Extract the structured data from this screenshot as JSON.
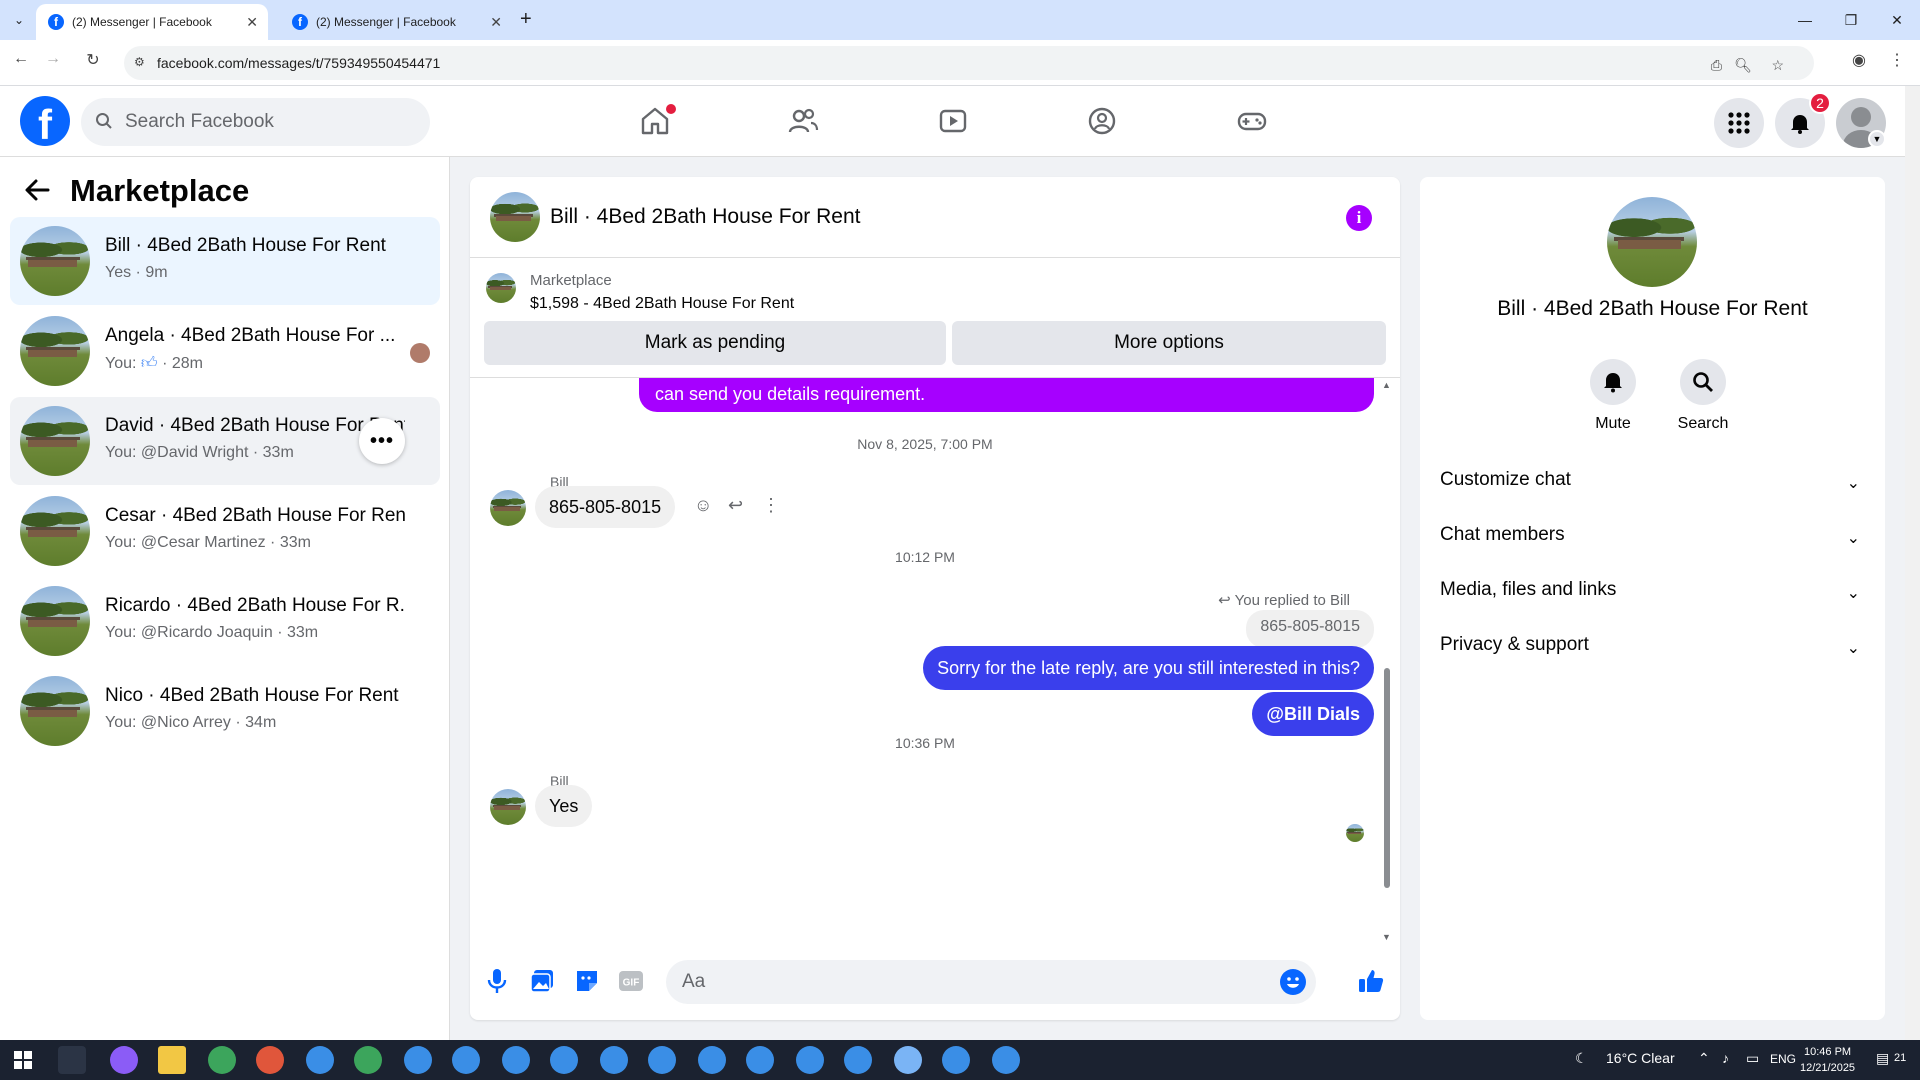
{
  "browser": {
    "tabs": [
      {
        "title": "(2) Messenger | Facebook",
        "active": true
      },
      {
        "title": "(2) Messenger | Facebook",
        "active": false
      }
    ],
    "url": "facebook.com/messages/t/759349550454471"
  },
  "fb_header": {
    "logo": "f",
    "search_placeholder": "Search Facebook",
    "notification_count": "2",
    "nav_icons": [
      "home-icon",
      "friends-icon",
      "video-icon",
      "groups-icon",
      "gaming-icon"
    ]
  },
  "left_pane": {
    "title": "Marketplace",
    "conversations": [
      {
        "name": "Bill · 4Bed 2Bath House For Rent",
        "meta": "Yes · 9m"
      },
      {
        "name": "Angela · 4Bed 2Bath House For ...",
        "meta_prefix": "You:",
        "meta": "· 28m"
      },
      {
        "name": "David · 4Bed 2Bath House For Rent",
        "meta": "You: @David Wright · 33m"
      },
      {
        "name": "Cesar · 4Bed 2Bath House For Rent",
        "meta": "You: @Cesar Martinez · 33m"
      },
      {
        "name": "Ricardo · 4Bed 2Bath House For R...",
        "meta": "You: @Ricardo Joaquin · 33m"
      },
      {
        "name": "Nico · 4Bed 2Bath House For Rent",
        "meta": "You: @Nico Arrey · 34m"
      }
    ]
  },
  "chat": {
    "title": "Bill · 4Bed 2Bath House For Rent",
    "marketplace_label": "Marketplace",
    "listing": "$1,598 - 4Bed 2Bath House For Rent",
    "mark_pending": "Mark as pending",
    "more_options": "More options",
    "partial_message": "can send you details requirement.",
    "timestamp1": "Nov 8, 2025, 7:00 PM",
    "sender1": "Bill",
    "received1": "865-805-8015",
    "timestamp2": "10:12 PM",
    "reply_note": "You replied to Bill",
    "quoted": "865-805-8015",
    "sent1": "Sorry for the late reply, are you still interested in this?",
    "sent2": "@Bill Dials",
    "timestamp3": "10:36 PM",
    "sender2": "Bill",
    "received2": "Yes",
    "composer_placeholder": "Aa"
  },
  "right_pane": {
    "name": "Bill · 4Bed 2Bath House For Rent",
    "actions": [
      {
        "label": "Mute"
      },
      {
        "label": "Search"
      }
    ],
    "sections": [
      "Customize chat",
      "Chat members",
      "Media, files and links",
      "Privacy & support"
    ]
  },
  "taskbar": {
    "weather": "16°C  Clear",
    "lang": "ENG",
    "time": "10:46 PM",
    "date": "12/21/2025",
    "notif_count": "21"
  },
  "colors": {
    "fb_blue": "#0866ff",
    "purple": "#a600ff",
    "sent_blue": "#3a3fec",
    "alert_red": "#e41e3f"
  }
}
